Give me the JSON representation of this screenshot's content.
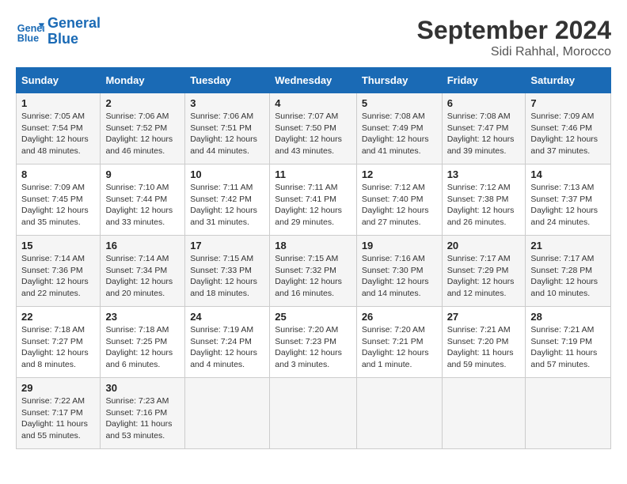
{
  "header": {
    "logo_line1": "General",
    "logo_line2": "Blue",
    "month": "September 2024",
    "location": "Sidi Rahhal, Morocco"
  },
  "weekdays": [
    "Sunday",
    "Monday",
    "Tuesday",
    "Wednesday",
    "Thursday",
    "Friday",
    "Saturday"
  ],
  "weeks": [
    [
      {
        "day": "1",
        "info": "Sunrise: 7:05 AM\nSunset: 7:54 PM\nDaylight: 12 hours\nand 48 minutes."
      },
      {
        "day": "2",
        "info": "Sunrise: 7:06 AM\nSunset: 7:52 PM\nDaylight: 12 hours\nand 46 minutes."
      },
      {
        "day": "3",
        "info": "Sunrise: 7:06 AM\nSunset: 7:51 PM\nDaylight: 12 hours\nand 44 minutes."
      },
      {
        "day": "4",
        "info": "Sunrise: 7:07 AM\nSunset: 7:50 PM\nDaylight: 12 hours\nand 43 minutes."
      },
      {
        "day": "5",
        "info": "Sunrise: 7:08 AM\nSunset: 7:49 PM\nDaylight: 12 hours\nand 41 minutes."
      },
      {
        "day": "6",
        "info": "Sunrise: 7:08 AM\nSunset: 7:47 PM\nDaylight: 12 hours\nand 39 minutes."
      },
      {
        "day": "7",
        "info": "Sunrise: 7:09 AM\nSunset: 7:46 PM\nDaylight: 12 hours\nand 37 minutes."
      }
    ],
    [
      {
        "day": "8",
        "info": "Sunrise: 7:09 AM\nSunset: 7:45 PM\nDaylight: 12 hours\nand 35 minutes."
      },
      {
        "day": "9",
        "info": "Sunrise: 7:10 AM\nSunset: 7:44 PM\nDaylight: 12 hours\nand 33 minutes."
      },
      {
        "day": "10",
        "info": "Sunrise: 7:11 AM\nSunset: 7:42 PM\nDaylight: 12 hours\nand 31 minutes."
      },
      {
        "day": "11",
        "info": "Sunrise: 7:11 AM\nSunset: 7:41 PM\nDaylight: 12 hours\nand 29 minutes."
      },
      {
        "day": "12",
        "info": "Sunrise: 7:12 AM\nSunset: 7:40 PM\nDaylight: 12 hours\nand 27 minutes."
      },
      {
        "day": "13",
        "info": "Sunrise: 7:12 AM\nSunset: 7:38 PM\nDaylight: 12 hours\nand 26 minutes."
      },
      {
        "day": "14",
        "info": "Sunrise: 7:13 AM\nSunset: 7:37 PM\nDaylight: 12 hours\nand 24 minutes."
      }
    ],
    [
      {
        "day": "15",
        "info": "Sunrise: 7:14 AM\nSunset: 7:36 PM\nDaylight: 12 hours\nand 22 minutes."
      },
      {
        "day": "16",
        "info": "Sunrise: 7:14 AM\nSunset: 7:34 PM\nDaylight: 12 hours\nand 20 minutes."
      },
      {
        "day": "17",
        "info": "Sunrise: 7:15 AM\nSunset: 7:33 PM\nDaylight: 12 hours\nand 18 minutes."
      },
      {
        "day": "18",
        "info": "Sunrise: 7:15 AM\nSunset: 7:32 PM\nDaylight: 12 hours\nand 16 minutes."
      },
      {
        "day": "19",
        "info": "Sunrise: 7:16 AM\nSunset: 7:30 PM\nDaylight: 12 hours\nand 14 minutes."
      },
      {
        "day": "20",
        "info": "Sunrise: 7:17 AM\nSunset: 7:29 PM\nDaylight: 12 hours\nand 12 minutes."
      },
      {
        "day": "21",
        "info": "Sunrise: 7:17 AM\nSunset: 7:28 PM\nDaylight: 12 hours\nand 10 minutes."
      }
    ],
    [
      {
        "day": "22",
        "info": "Sunrise: 7:18 AM\nSunset: 7:27 PM\nDaylight: 12 hours\nand 8 minutes."
      },
      {
        "day": "23",
        "info": "Sunrise: 7:18 AM\nSunset: 7:25 PM\nDaylight: 12 hours\nand 6 minutes."
      },
      {
        "day": "24",
        "info": "Sunrise: 7:19 AM\nSunset: 7:24 PM\nDaylight: 12 hours\nand 4 minutes."
      },
      {
        "day": "25",
        "info": "Sunrise: 7:20 AM\nSunset: 7:23 PM\nDaylight: 12 hours\nand 3 minutes."
      },
      {
        "day": "26",
        "info": "Sunrise: 7:20 AM\nSunset: 7:21 PM\nDaylight: 12 hours\nand 1 minute."
      },
      {
        "day": "27",
        "info": "Sunrise: 7:21 AM\nSunset: 7:20 PM\nDaylight: 11 hours\nand 59 minutes."
      },
      {
        "day": "28",
        "info": "Sunrise: 7:21 AM\nSunset: 7:19 PM\nDaylight: 11 hours\nand 57 minutes."
      }
    ],
    [
      {
        "day": "29",
        "info": "Sunrise: 7:22 AM\nSunset: 7:17 PM\nDaylight: 11 hours\nand 55 minutes."
      },
      {
        "day": "30",
        "info": "Sunrise: 7:23 AM\nSunset: 7:16 PM\nDaylight: 11 hours\nand 53 minutes."
      },
      {
        "day": "",
        "info": ""
      },
      {
        "day": "",
        "info": ""
      },
      {
        "day": "",
        "info": ""
      },
      {
        "day": "",
        "info": ""
      },
      {
        "day": "",
        "info": ""
      }
    ]
  ]
}
